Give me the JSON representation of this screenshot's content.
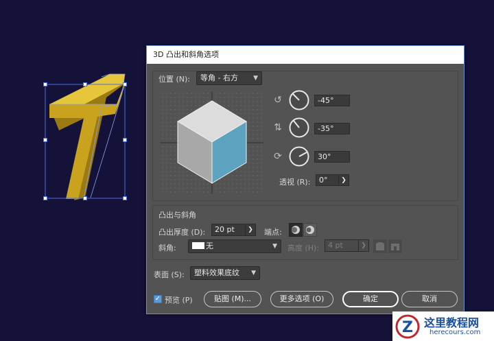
{
  "dialog": {
    "title": "3D 凸出和斜角选项"
  },
  "position": {
    "label": "位置 (N):",
    "selected": "等角 - 右方",
    "rot_x_value": "-45°",
    "rot_y_value": "-35°",
    "rot_z_value": "30°",
    "perspective_label": "透视 (R):",
    "perspective_value": "0°"
  },
  "extrude": {
    "section_label": "凸出与斜角",
    "depth_label": "凸出厚度 (D):",
    "depth_value": "20 pt",
    "cap_label": "端点:",
    "bevel_label": "斜角:",
    "bevel_value": "无",
    "height_label": "高度 (H):",
    "height_value": "4 pt"
  },
  "surface": {
    "label": "表面 (S):",
    "selected": "塑料效果底纹"
  },
  "footer": {
    "preview_label": "预览 (P)",
    "preview_checked": true,
    "map_button": "贴图 (M)...",
    "more_options_button": "更多选项 (O)",
    "ok_button": "确定",
    "cancel_button": "取消"
  },
  "artwork": {
    "glyph": "7",
    "fill_color": "#c9a21e"
  },
  "watermark": {
    "title": "这里教程网",
    "url": "herecours.com"
  },
  "colors": {
    "canvas_bg": "#15123a",
    "dialog_bg": "#535353",
    "cube_front": "#5da3bf",
    "selection": "#4a6fe3"
  }
}
